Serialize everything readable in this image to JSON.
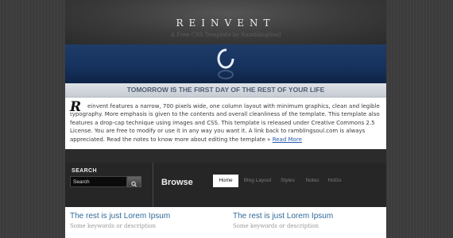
{
  "header": {
    "title": "REINVENT",
    "subtitle": "A Free CSS Template by RamblingSoul"
  },
  "tagline": "TOMORROW IS THE FIRST DAY OF THE REST OF YOUR LIFE",
  "content": {
    "dropcap": "R",
    "text": "einvent features a narrow, 700 pixels wide, one column layout with minimum graphics, clean and legible typography. More emphasis is given to the contents and overall cleanliness of the template. This template also features a drop-cap technique using images and CSS. This template is released under Creative Commons 2.5 License. You are free to modify or use it in any way you want it. A link back to ramblingsoul.com is always appreciated. Read the notes to know more about editing the template » ",
    "read_more": "Read More"
  },
  "search": {
    "label": "SEARCH",
    "placeholder": "Search"
  },
  "nav": {
    "heading": "Browse",
    "tabs": [
      "Home",
      "Blog Layout",
      "Styles",
      "Notes",
      "HoGo"
    ]
  },
  "posts": [
    {
      "title": "The rest is just Lorem Ipsum",
      "subtitle": "Some keywords or description"
    },
    {
      "title": "The rest is just Lorem Ipsum",
      "subtitle": "Some keywords or description"
    }
  ],
  "colors": {
    "accent": "#2f6a9a",
    "banner": "#1f3c6a"
  }
}
